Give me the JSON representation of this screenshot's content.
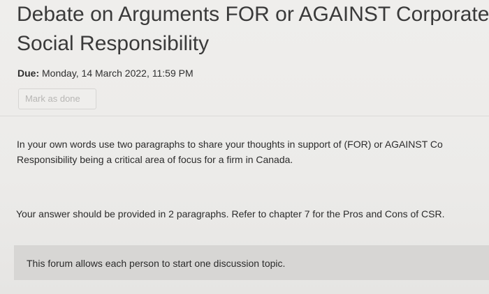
{
  "page": {
    "title": "Debate on Arguments FOR or AGAINST Corporate Social Responsibility",
    "due_label": "Due:",
    "due_value": " Monday, 14 March 2022, 11:59 PM",
    "mark_done_label": "Mark as done"
  },
  "content": {
    "intro_line1": "In your own words use two paragraphs to share your thoughts in support of (FOR) or AGAINST Co",
    "intro_line2": "Responsibility being a critical area of focus for a firm in Canada.",
    "answer_text": "Your answer should be provided in 2 paragraphs. Refer to chapter 7 for the Pros and Cons of CSR.",
    "forum_notice": "This forum allows each person to start one discussion topic."
  }
}
